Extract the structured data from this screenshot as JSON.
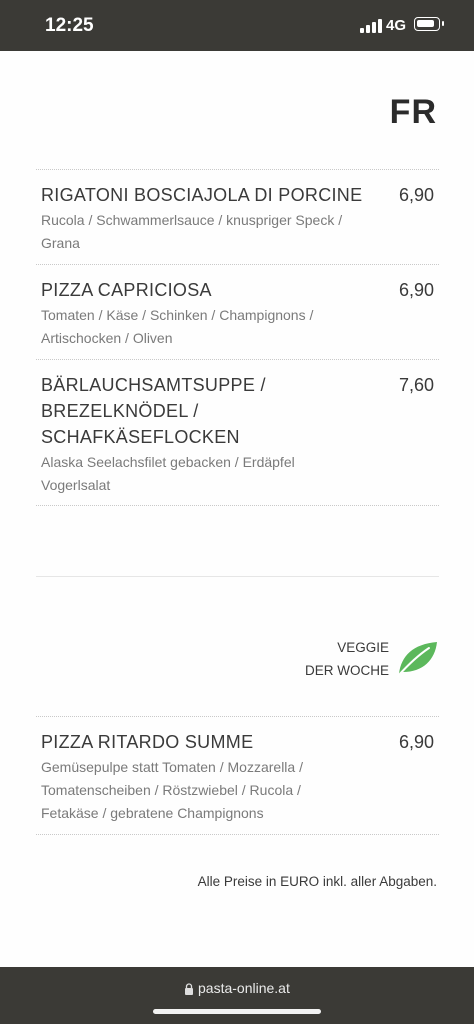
{
  "status_bar": {
    "time": "12:25",
    "network": "4G"
  },
  "header": {
    "day": "FR"
  },
  "menu_items": [
    {
      "name": "RIGATONI BOSCIAJOLA DI PORCINE",
      "price": "6,90",
      "description": "Rucola / Schwammerlsauce / knuspriger Speck / Grana"
    },
    {
      "name": "PIZZA CAPRICIOSA",
      "price": "6,90",
      "description": "Tomaten / Käse / Schinken / Champignons / Artischocken / Oliven"
    },
    {
      "name": "BÄRLAUCHSAMTSUPPE / BREZELKNÖDEL / SCHAFKÄSEFLOCKEN",
      "price": "7,60",
      "description": "Alaska Seelachsfilet gebacken / Erdäpfel Vogerlsalat"
    }
  ],
  "veggie": {
    "line1": "VEGGIE",
    "line2": "DER WOCHE",
    "icon": "leaf-icon",
    "color": "#5cb85c",
    "item": {
      "name": "PIZZA RITARDO SUMME",
      "price": "6,90",
      "description": "Gemüsepulpe statt Tomaten / Mozzarella / Tomatenscheiben / Röstzwiebel / Rucola / Fetakäse / gebratene Champignons"
    }
  },
  "footnote": "Alle Preise in EURO inkl. aller Abgaben.",
  "browser": {
    "url": "pasta-online.at"
  }
}
